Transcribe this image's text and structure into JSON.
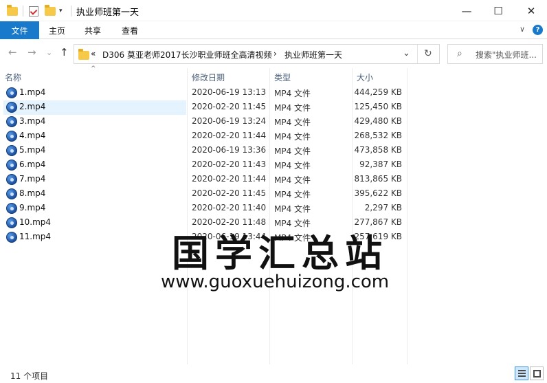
{
  "titlebar": {
    "title": "执业师班第一天",
    "minimize": "—",
    "maximize": "☐",
    "close": "✕",
    "qa_dropdown": "▾"
  },
  "ribbon": {
    "file_tab": "文件",
    "tabs": [
      "主页",
      "共享",
      "查看"
    ],
    "collapse": "∨",
    "help": "?",
    "accent_color": "#1979ca"
  },
  "nav": {
    "back": "←",
    "forward": "→",
    "recent": "⌄",
    "up": "↑",
    "overflow": "«",
    "path": [
      "D306 莫亚老师2017长沙职业师班全高清视频",
      "执业师班第一天"
    ],
    "sep": "›",
    "dropdown": "⌄",
    "refresh": "↻",
    "search_icon": "⌕",
    "search_placeholder": "搜索\"执业师班..."
  },
  "columns": {
    "name": "名称",
    "date": "修改日期",
    "type": "类型",
    "size": "大小",
    "sort_arrow": "^"
  },
  "files": [
    {
      "name": "1.mp4",
      "date": "2020-06-19 13:13",
      "type": "MP4 文件",
      "size": "444,259 KB"
    },
    {
      "name": "2.mp4",
      "date": "2020-02-20 11:45",
      "type": "MP4 文件",
      "size": "125,450 KB"
    },
    {
      "name": "3.mp4",
      "date": "2020-06-19 13:24",
      "type": "MP4 文件",
      "size": "429,480 KB"
    },
    {
      "name": "4.mp4",
      "date": "2020-02-20 11:44",
      "type": "MP4 文件",
      "size": "268,532 KB"
    },
    {
      "name": "5.mp4",
      "date": "2020-06-19 13:36",
      "type": "MP4 文件",
      "size": "473,858 KB"
    },
    {
      "name": "6.mp4",
      "date": "2020-02-20 11:43",
      "type": "MP4 文件",
      "size": "92,387 KB"
    },
    {
      "name": "7.mp4",
      "date": "2020-02-20 11:44",
      "type": "MP4 文件",
      "size": "813,865 KB"
    },
    {
      "name": "8.mp4",
      "date": "2020-02-20 11:45",
      "type": "MP4 文件",
      "size": "395,622 KB"
    },
    {
      "name": "9.mp4",
      "date": "2020-02-20 11:40",
      "type": "MP4 文件",
      "size": "2,297 KB"
    },
    {
      "name": "10.mp4",
      "date": "2020-02-20 11:48",
      "type": "MP4 文件",
      "size": "277,867 KB"
    },
    {
      "name": "11.mp4",
      "date": "2020-06-19 13:44",
      "type": "MP4 文件",
      "size": "257,619 KB"
    }
  ],
  "selected_index": 1,
  "watermark": {
    "text": "国学汇总站",
    "url": "www.guoxuehuizong.com"
  },
  "status": {
    "item_count": "11 个项目"
  }
}
